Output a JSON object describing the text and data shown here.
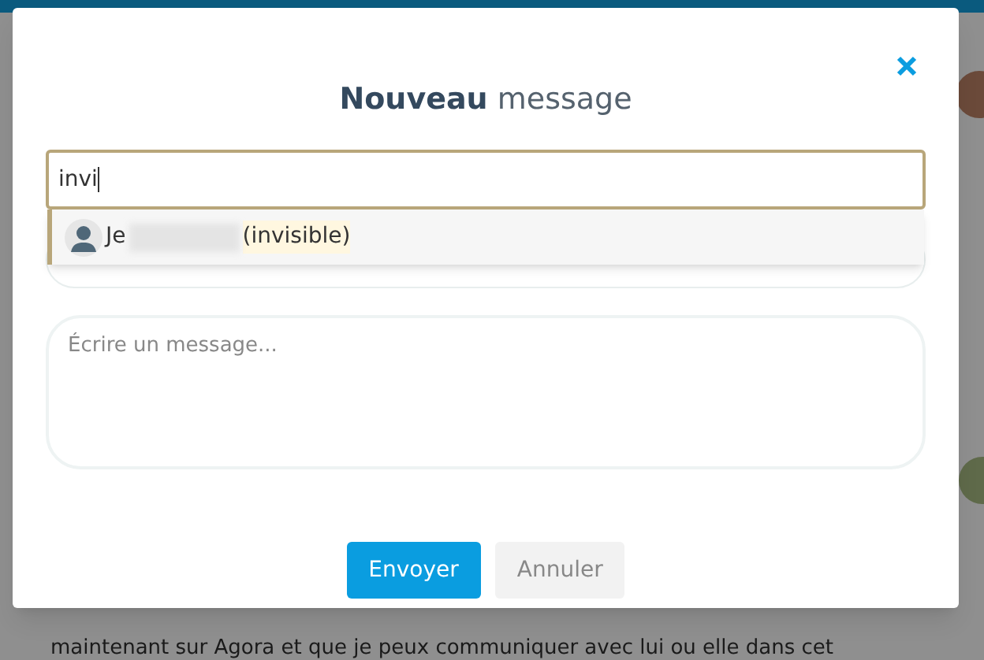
{
  "background": {
    "text": "maintenant sur Agora et que je peux communiquer avec lui ou elle dans cet"
  },
  "dialog": {
    "title_bold": "Nouveau",
    "title_rest": "message",
    "recipient": {
      "value": "invi"
    },
    "suggestions": [
      {
        "name_start": "Je",
        "name_end": "(invisible)",
        "selected": true
      }
    ],
    "message": {
      "placeholder": "Écrire un message..."
    },
    "buttons": [
      {
        "label": "Envoyer",
        "kind": "primary"
      },
      {
        "label": "Annuler",
        "kind": "secondary"
      }
    ]
  }
}
